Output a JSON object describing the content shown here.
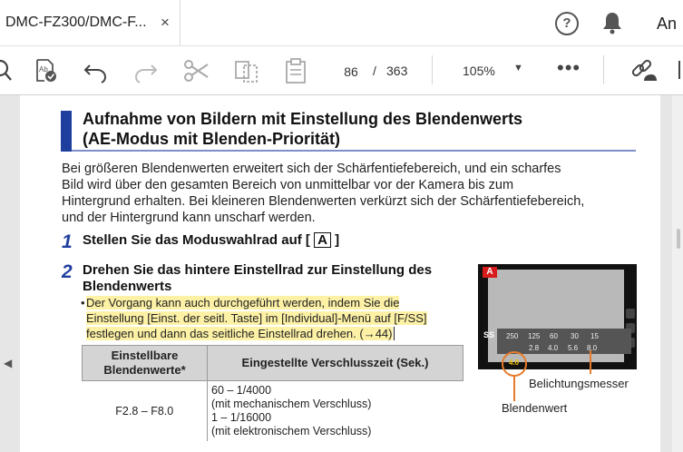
{
  "tab": {
    "title": "DMC-FZ300/DMC-F...",
    "close": "×"
  },
  "header": {
    "help": "?",
    "user": "An"
  },
  "toolbar": {
    "page_current": "86",
    "page_sep": "/",
    "page_total": "363",
    "zoom": "105%",
    "zoom_caret": "▼",
    "more": "•••"
  },
  "icons": [
    "search-icon",
    "spellcheck-icon",
    "undo-icon",
    "redo-icon",
    "scissors-icon",
    "compare-icon",
    "clipboard-icon",
    "zoom-dropdown-icon",
    "more-icon",
    "link-icon",
    "bell-icon",
    "help-icon"
  ],
  "document": {
    "heading_line1": "Aufnahme von Bildern mit Einstellung des Blendenwerts",
    "heading_line2": "(AE-Modus mit Blenden-Priorität)",
    "intro_line1": "Bei größeren Blendenwerten erweitert sich der Schärfentiefebereich, und ein scharfes",
    "intro_line2": "Bild wird über den gesamten Bereich von unmittelbar vor der Kamera bis zum",
    "intro_line3": "Hintergrund erhalten. Bei kleineren Blendenwerten verkürzt sich der Schärfentiefebereich,",
    "intro_line4": "und der Hintergrund kann unscharf werden.",
    "step1_num": "1",
    "step1_text": "Stellen Sie das Moduswahlrad auf [",
    "step1_mode": "A",
    "step1_end": "]",
    "step2_num": "2",
    "step2_line1": "Drehen Sie das hintere Einstellrad zur Einstellung des",
    "step2_line2": "Blendenwerts",
    "note_bullet": "•",
    "note_line1": "Der Vorgang kann auch durchgeführt werden, indem Sie die",
    "note_line2": "Einstellung [Einst. der seitl. Taste] im [Individual]-Menü auf [F/SS]",
    "note_line3": "festlegen und dann das seitliche Einstellrad drehen. (→44)",
    "table": {
      "header_col1_line1": "Einstellbare",
      "header_col1_line2": "Blendenwerte*",
      "header_col2": "Eingestellte Verschlusszeit (Sek.)",
      "row1_col1": "F2.8 – F8.0",
      "row1_col2_line1": "60 – 1/4000",
      "row1_col2_line2": "(mit mechanischem Verschluss)",
      "row1_col2_line3": "1 – 1/16000",
      "row1_col2_line4": "(mit elektronischem Verschluss)"
    },
    "figure": {
      "mode_badge": "A",
      "ss_label": "SS",
      "scale_top": [
        "250",
        "125",
        "60",
        "30",
        "15"
      ],
      "scale_bottom": [
        "2.8",
        "4.0",
        "5.6",
        "8.0"
      ],
      "aperture_value": "4.0",
      "label_aperture": "Blendenwert",
      "label_meter": "Belichtungsmesser"
    }
  },
  "colors": {
    "accent_blue": "#1f3f9f",
    "highlight": "#fdf1a6",
    "callout_orange": "#e57b2c",
    "badge_red": "#d81c1c"
  }
}
